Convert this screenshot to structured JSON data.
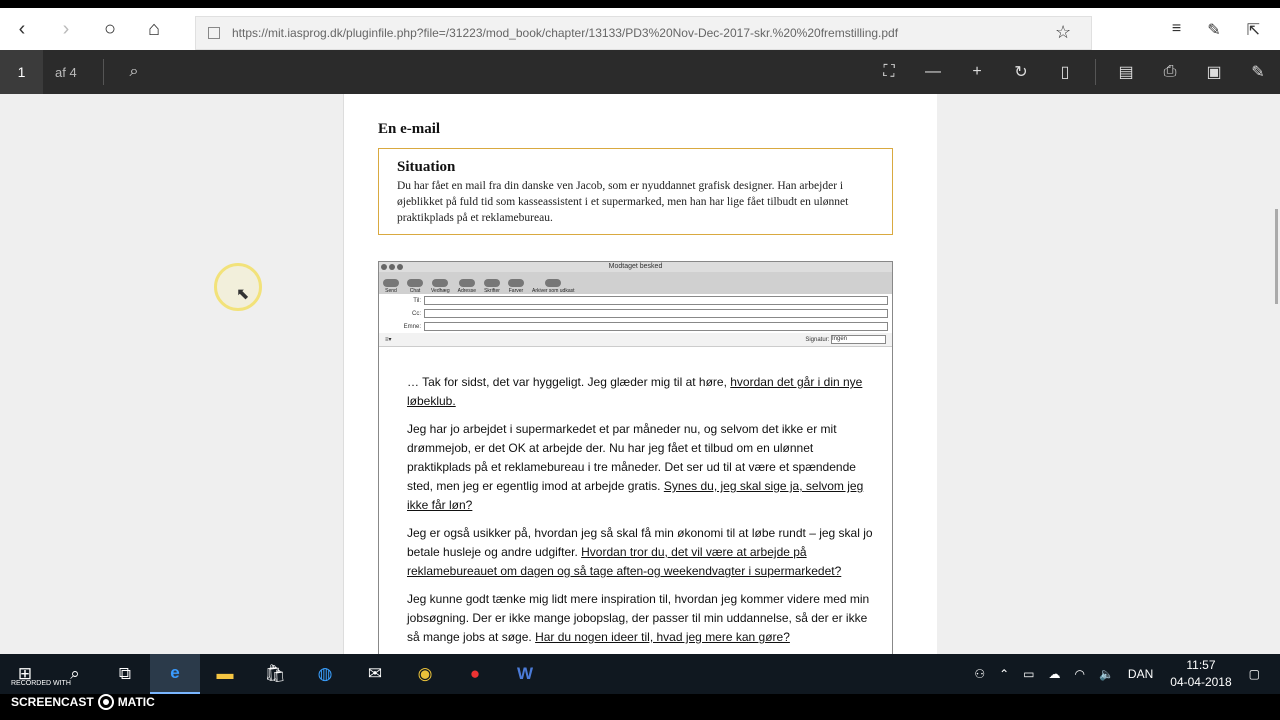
{
  "browser": {
    "url": "https://mit.iasprog.dk/pluginfile.php?file=/31223/mod_book/chapter/13133/PD3%20Nov-Dec-2017-skr.%20%20fremstilling.pdf",
    "back_icon": "back-icon",
    "forward_icon": "forward-icon",
    "refresh_icon": "refresh-icon",
    "home_icon": "home-icon"
  },
  "pdf_toolbar": {
    "page_number": "1",
    "page_of": "af 4"
  },
  "document": {
    "heading": "En e-mail",
    "situation_title": "Situation",
    "situation_text": "Du har fået en mail fra din danske ven Jacob, som er nyuddannet grafisk designer. Han arbejder i øjeblikket på fuld tid som kasseassistent i et supermarked, men han har lige fået tilbudt en ulønnet praktikplads på et reklamebureau."
  },
  "mail_window": {
    "title": "Modtaget besked",
    "toolbar": [
      "Send",
      "Chat",
      "Vedhæg",
      "Adresse",
      "Skrifter",
      "Farver",
      "Arkiver som udkast"
    ],
    "fields": [
      "Til:",
      "Cc:",
      "Emne:"
    ],
    "signature_label": "Signatur:",
    "signature_value": "Ingen",
    "body": [
      {
        "plain": "… Tak for sidst, det var hyggeligt. Jeg glæder mig til at høre, ",
        "underlined": "hvordan det går i din nye løbeklub."
      },
      {
        "plain": "Jeg har jo arbejdet i supermarkedet et par måneder nu, og selvom det ikke er mit drømmejob, er det OK at arbejde der. Nu har jeg fået et tilbud om en ulønnet praktikplads på et reklamebureau i tre måneder. Det ser ud til at være et spændende sted, men jeg er egentlig imod at arbejde gratis. ",
        "underlined": "Synes du, jeg skal sige ja, selvom jeg ikke får løn?"
      },
      {
        "plain": "Jeg er også usikker på, hvordan jeg så skal få min økonomi til at løbe rundt – jeg skal jo betale husleje og andre udgifter. ",
        "underlined": "Hvordan tror du, det vil være at arbejde på reklamebureauet om dagen og så tage aften-og weekendvagter i supermarkedet?"
      },
      {
        "plain": "Jeg kunne godt tænke mig lidt mere inspiration til, hvordan jeg kommer videre med min jobsøgning. Der er ikke mange jobopslag, der passer til min uddannelse, så der er ikke så mange jobs at søge. ",
        "underlined": "Har du nogen ideer til, hvad jeg mere kan gøre?"
      }
    ]
  },
  "taskbar": {
    "language": "DAN",
    "time": "11:57",
    "date": "04-04-2018"
  },
  "watermark": {
    "recorded_with": "RECORDED WITH",
    "brand_left": "SCREENCAST",
    "brand_right": "MATIC"
  }
}
